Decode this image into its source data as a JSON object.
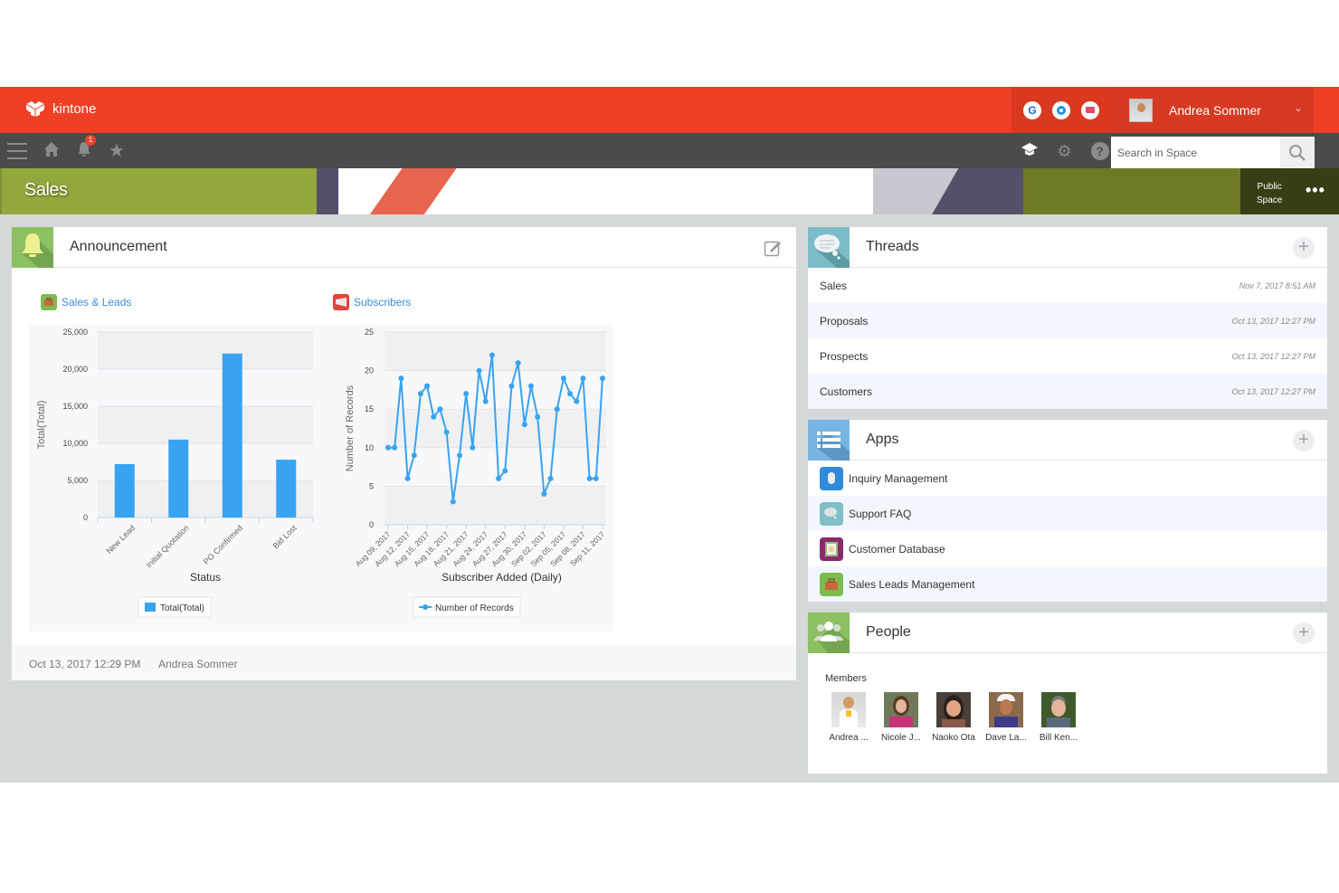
{
  "header": {
    "app_name": "kintone",
    "services": [
      {
        "icon": "google-icon",
        "glyph": "G"
      },
      {
        "icon": "office-icon",
        "glyph": ""
      },
      {
        "icon": "mail-icon",
        "glyph": ""
      }
    ],
    "user_name": "Andrea Sommer",
    "notification_count": "1"
  },
  "nav": {
    "search_placeholder": "Search in Space"
  },
  "space": {
    "title": "Sales",
    "visibility_line1": "Public",
    "visibility_line2": "Space",
    "menu_glyph": "•••"
  },
  "announcement": {
    "title": "Announcement",
    "footer_date": "Oct 13, 2017 12:29 PM",
    "footer_author": "Andrea Sommer",
    "links": [
      {
        "label": "Sales & Leads"
      },
      {
        "label": "Subscribers"
      }
    ]
  },
  "chart_data": [
    {
      "type": "bar",
      "title": "",
      "xlabel": "Status",
      "ylabel": "Total(Total)",
      "categories": [
        "New Lead",
        "Initial Quotation",
        "PO Confirmed",
        "Bid Lost"
      ],
      "values": [
        7200,
        10500,
        22100,
        7800
      ],
      "ylim": [
        0,
        25000
      ],
      "yticks": [
        0,
        5000,
        10000,
        15000,
        20000,
        25000
      ],
      "ytick_labels": [
        "0",
        "5,000",
        "10,000",
        "15,000",
        "20,000",
        "25,000"
      ],
      "legend": [
        "Total(Total)"
      ],
      "legend_position": "bottom",
      "color": "#38a3f1",
      "grid": true
    },
    {
      "type": "line",
      "title": "",
      "xlabel": "Subscriber Added (Daily)",
      "ylabel": "Number of Records",
      "x": [
        "Aug 09, 2017",
        "Aug 10, 2017",
        "Aug 11, 2017",
        "Aug 12, 2017",
        "Aug 13, 2017",
        "Aug 14, 2017",
        "Aug 15, 2017",
        "Aug 16, 2017",
        "Aug 17, 2017",
        "Aug 18, 2017",
        "Aug 19, 2017",
        "Aug 20, 2017",
        "Aug 21, 2017",
        "Aug 22, 2017",
        "Aug 23, 2017",
        "Aug 24, 2017",
        "Aug 25, 2017",
        "Aug 26, 2017",
        "Aug 27, 2017",
        "Aug 28, 2017",
        "Aug 29, 2017",
        "Aug 30, 2017",
        "Aug 31, 2017",
        "Sep 01, 2017",
        "Sep 02, 2017",
        "Sep 03, 2017",
        "Sep 04, 2017",
        "Sep 05, 2017",
        "Sep 06, 2017",
        "Sep 07, 2017",
        "Sep 08, 2017",
        "Sep 09, 2017",
        "Sep 10, 2017",
        "Sep 11, 2017"
      ],
      "values": [
        10,
        10,
        19,
        6,
        9,
        17,
        18,
        14,
        15,
        12,
        3,
        9,
        17,
        10,
        20,
        16,
        22,
        6,
        7,
        18,
        21,
        13,
        18,
        14,
        4,
        6,
        15,
        19,
        17,
        16,
        19,
        6,
        6,
        19
      ],
      "xtick_labels": [
        "Aug 09, 2017",
        "Aug 12, 2017",
        "Aug 15, 2017",
        "Aug 18, 2017",
        "Aug 21, 2017",
        "Aug 24, 2017",
        "Aug 27, 2017",
        "Aug 30, 2017",
        "Sep 02, 2017",
        "Sep 05, 2017",
        "Sep 08, 2017",
        "Sep 11, 2017"
      ],
      "ylim": [
        0,
        25
      ],
      "yticks": [
        0,
        5,
        10,
        15,
        20,
        25
      ],
      "legend": [
        "Number of Records"
      ],
      "legend_position": "bottom",
      "color": "#38a3f1",
      "grid": true
    }
  ],
  "threads": {
    "title": "Threads",
    "items": [
      {
        "name": "Sales",
        "timestamp": "Nov 7, 2017 8:51 AM"
      },
      {
        "name": "Proposals",
        "timestamp": "Oct 13, 2017 12:27 PM"
      },
      {
        "name": "Prospects",
        "timestamp": "Oct 13, 2017 12:27 PM"
      },
      {
        "name": "Customers",
        "timestamp": "Oct 13, 2017 12:27 PM"
      }
    ]
  },
  "apps": {
    "title": "Apps",
    "items": [
      {
        "name": "Inquiry Management",
        "icon": "mouse-icon",
        "color": "#2f8ad8"
      },
      {
        "name": "Support FAQ",
        "icon": "chat-bubble-icon",
        "color": "#7fbfc6"
      },
      {
        "name": "Customer Database",
        "icon": "contact-card-icon",
        "color": "#8a2a6e"
      },
      {
        "name": "Sales Leads Management",
        "icon": "briefcase-icon",
        "color": "#7dbb4f"
      }
    ]
  },
  "people": {
    "title": "People",
    "members_label": "Members",
    "members": [
      {
        "name": "Andrea ..."
      },
      {
        "name": "Nicole J..."
      },
      {
        "name": "Naoko Ota"
      },
      {
        "name": "Dave La..."
      },
      {
        "name": "Bill Ken..."
      }
    ]
  }
}
